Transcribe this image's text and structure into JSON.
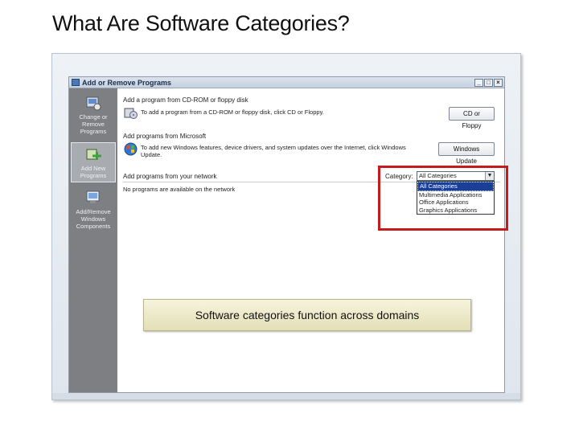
{
  "slide": {
    "title": "What Are Software Categories?"
  },
  "window": {
    "title": "Add or Remove Programs",
    "controls": {
      "minimize": "_",
      "maximize": "□",
      "close": "×"
    }
  },
  "sidebar": {
    "items": [
      {
        "label": "Change or Remove Programs",
        "icon": "change-remove-programs-icon"
      },
      {
        "label": "Add New Programs",
        "icon": "add-new-programs-icon",
        "active": true
      },
      {
        "label": "Add/Remove Windows Components",
        "icon": "windows-components-icon"
      }
    ]
  },
  "content": {
    "cd_section": {
      "label": "Add a program from CD-ROM or floppy disk",
      "text": "To add a program from a CD-ROM or floppy disk, click CD or Floppy.",
      "button": "CD or Floppy"
    },
    "microsoft_section": {
      "label": "Add programs from Microsoft",
      "text": "To add new Windows features, device drivers, and system updates over the Internet, click Windows Update.",
      "button": "Windows Update"
    },
    "network_section": {
      "label": "Add programs from your network",
      "category_label": "Category:",
      "category_selected": "All Categories",
      "category_options": [
        "All Categories",
        "Multimedia Applications",
        "Office Applications",
        "Graphics Applications"
      ],
      "empty_message": "No programs are available on the network"
    }
  },
  "callout": {
    "text": "Software categories function across domains"
  },
  "colors": {
    "highlight": "#c41b1b",
    "sidebar": "#7d7f82",
    "selection": "#1b3f99"
  }
}
